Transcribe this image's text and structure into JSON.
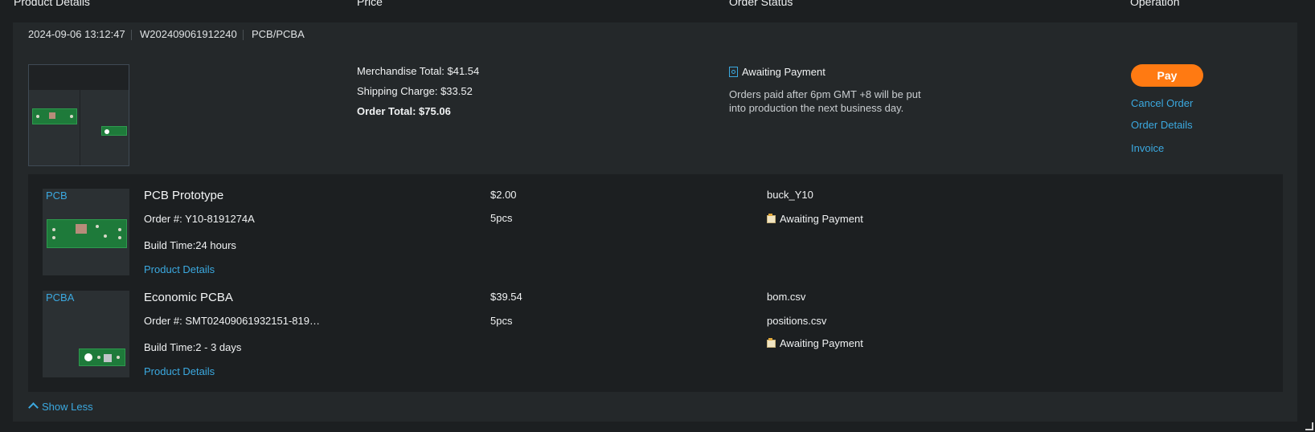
{
  "table_header": {
    "product_details": "Product Details",
    "price": "Price",
    "order_status": "Order Status",
    "operation": "Operation"
  },
  "order": {
    "datetime": "2024-09-06 13:12:47",
    "order_id": "W202409061912240",
    "category": "PCB/PCBA",
    "merchandise_total": "Merchandise Total: $41.54",
    "shipping_charge": "Shipping Charge: $33.52",
    "order_total": "Order Total: $75.06",
    "status": "Awaiting Payment",
    "status_note": "Orders paid after 6pm GMT +8 will be put into production the next business day.",
    "actions": {
      "pay": "Pay",
      "cancel": "Cancel Order",
      "details": "Order Details",
      "invoice": "Invoice"
    },
    "items": [
      {
        "tag": "PCB",
        "title": "PCB Prototype",
        "order_no_label": "Order #:",
        "order_no": "Y10-8191274A",
        "build_time": "Build Time:24 hours",
        "link": "Product Details",
        "price": "$2.00",
        "qty": "5pcs",
        "files": [
          "buck_Y10"
        ],
        "status": "Awaiting Payment"
      },
      {
        "tag": "PCBA",
        "title": "Economic PCBA",
        "order_no_label": "Order #:",
        "order_no": "SMT02409061932151-819…",
        "build_time": "Build Time:2 - 3 days",
        "link": "Product Details",
        "price": "$39.54",
        "qty": "5pcs",
        "files": [
          "bom.csv",
          "positions.csv"
        ],
        "status": "Awaiting Payment"
      }
    ],
    "show_less": "Show Less"
  },
  "icons": {
    "status_main": "doc-search-icon",
    "status_item": "folder-icon",
    "collapse": "chevron-up-icon"
  },
  "colors": {
    "accent_link": "#3ba9e0",
    "pay_button": "#ff7a12",
    "background": "#1c1f21",
    "card": "#24282a"
  }
}
